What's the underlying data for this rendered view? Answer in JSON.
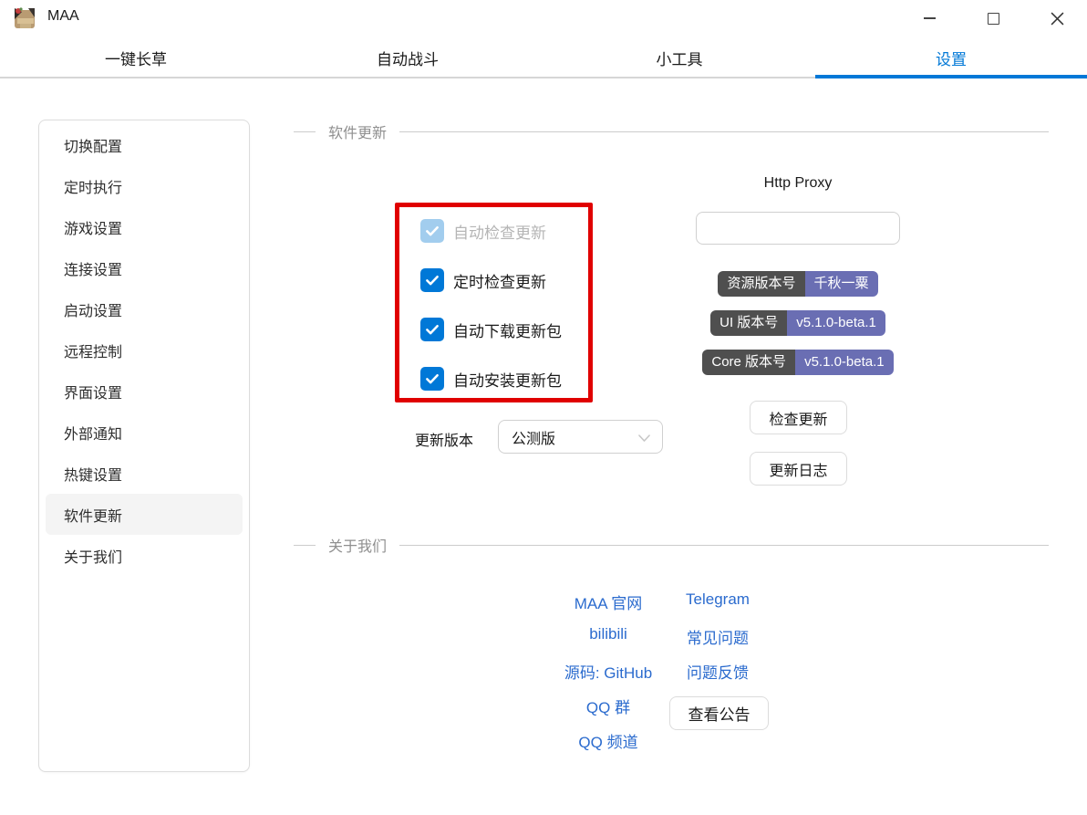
{
  "window": {
    "title": "MAA",
    "controls": [
      "minimize",
      "maximize",
      "close"
    ]
  },
  "tabs": [
    {
      "label": "一键长草",
      "active": false
    },
    {
      "label": "自动战斗",
      "active": false
    },
    {
      "label": "小工具",
      "active": false
    },
    {
      "label": "设置",
      "active": true
    }
  ],
  "sidebar": {
    "items": [
      {
        "label": "切换配置",
        "selected": false
      },
      {
        "label": "定时执行",
        "selected": false
      },
      {
        "label": "游戏设置",
        "selected": false
      },
      {
        "label": "连接设置",
        "selected": false
      },
      {
        "label": "启动设置",
        "selected": false
      },
      {
        "label": "远程控制",
        "selected": false
      },
      {
        "label": "界面设置",
        "selected": false
      },
      {
        "label": "外部通知",
        "selected": false
      },
      {
        "label": "热键设置",
        "selected": false
      },
      {
        "label": "软件更新",
        "selected": true
      },
      {
        "label": "关于我们",
        "selected": false
      }
    ]
  },
  "update_section": {
    "title": "软件更新",
    "checkboxes": [
      {
        "label": "自动检查更新",
        "checked": true,
        "disabled": true
      },
      {
        "label": "定时检查更新",
        "checked": true,
        "disabled": false
      },
      {
        "label": "自动下载更新包",
        "checked": true,
        "disabled": false
      },
      {
        "label": "自动安装更新包",
        "checked": true,
        "disabled": false
      }
    ],
    "http_proxy_label": "Http Proxy",
    "proxy_value": "",
    "badges": [
      {
        "key": "资源版本号",
        "value": "千秋一粟"
      },
      {
        "key": "UI 版本号",
        "value": "v5.1.0-beta.1"
      },
      {
        "key": "Core 版本号",
        "value": "v5.1.0-beta.1"
      }
    ],
    "channel_label": "更新版本",
    "channel_value": "公测版",
    "check_update_button": "检查更新",
    "changelog_button": "更新日志"
  },
  "about_section": {
    "title": "关于我们",
    "links_left": [
      "MAA 官网",
      "bilibili",
      "源码: GitHub",
      "QQ 群",
      "QQ 频道"
    ],
    "links_right": [
      "Telegram",
      "常见问题",
      "问题反馈"
    ],
    "announcement_button": "查看公告"
  },
  "colors": {
    "accent": "#0078d7",
    "checkbox_checked": "#0078d7",
    "checkbox_disabled": "#a2cdee",
    "badge_key_bg": "#4f4f4f",
    "badge_value_bg": "#6a6eb3",
    "link": "#2b6bce",
    "annotation_red": "#e00000"
  }
}
